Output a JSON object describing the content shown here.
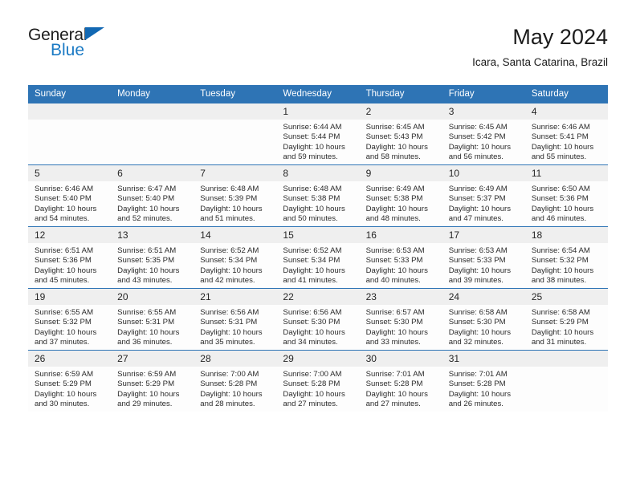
{
  "brand": {
    "name_top": "General",
    "name_bottom": "Blue",
    "accent_color": "#1b7ac4",
    "triangle_color": "#1268b3"
  },
  "header": {
    "title": "May 2024",
    "subtitle": "Icara, Santa Catarina, Brazil"
  },
  "calendar": {
    "header_bg": "#2e74b5",
    "daynum_bg": "#efefef",
    "weekdays": [
      "Sunday",
      "Monday",
      "Tuesday",
      "Wednesday",
      "Thursday",
      "Friday",
      "Saturday"
    ],
    "weeks": [
      [
        {
          "day": "",
          "sunrise": "",
          "sunset": "",
          "daylight_1": "",
          "daylight_2": ""
        },
        {
          "day": "",
          "sunrise": "",
          "sunset": "",
          "daylight_1": "",
          "daylight_2": ""
        },
        {
          "day": "",
          "sunrise": "",
          "sunset": "",
          "daylight_1": "",
          "daylight_2": ""
        },
        {
          "day": "1",
          "sunrise": "Sunrise: 6:44 AM",
          "sunset": "Sunset: 5:44 PM",
          "daylight_1": "Daylight: 10 hours",
          "daylight_2": "and 59 minutes."
        },
        {
          "day": "2",
          "sunrise": "Sunrise: 6:45 AM",
          "sunset": "Sunset: 5:43 PM",
          "daylight_1": "Daylight: 10 hours",
          "daylight_2": "and 58 minutes."
        },
        {
          "day": "3",
          "sunrise": "Sunrise: 6:45 AM",
          "sunset": "Sunset: 5:42 PM",
          "daylight_1": "Daylight: 10 hours",
          "daylight_2": "and 56 minutes."
        },
        {
          "day": "4",
          "sunrise": "Sunrise: 6:46 AM",
          "sunset": "Sunset: 5:41 PM",
          "daylight_1": "Daylight: 10 hours",
          "daylight_2": "and 55 minutes."
        }
      ],
      [
        {
          "day": "5",
          "sunrise": "Sunrise: 6:46 AM",
          "sunset": "Sunset: 5:40 PM",
          "daylight_1": "Daylight: 10 hours",
          "daylight_2": "and 54 minutes."
        },
        {
          "day": "6",
          "sunrise": "Sunrise: 6:47 AM",
          "sunset": "Sunset: 5:40 PM",
          "daylight_1": "Daylight: 10 hours",
          "daylight_2": "and 52 minutes."
        },
        {
          "day": "7",
          "sunrise": "Sunrise: 6:48 AM",
          "sunset": "Sunset: 5:39 PM",
          "daylight_1": "Daylight: 10 hours",
          "daylight_2": "and 51 minutes."
        },
        {
          "day": "8",
          "sunrise": "Sunrise: 6:48 AM",
          "sunset": "Sunset: 5:38 PM",
          "daylight_1": "Daylight: 10 hours",
          "daylight_2": "and 50 minutes."
        },
        {
          "day": "9",
          "sunrise": "Sunrise: 6:49 AM",
          "sunset": "Sunset: 5:38 PM",
          "daylight_1": "Daylight: 10 hours",
          "daylight_2": "and 48 minutes."
        },
        {
          "day": "10",
          "sunrise": "Sunrise: 6:49 AM",
          "sunset": "Sunset: 5:37 PM",
          "daylight_1": "Daylight: 10 hours",
          "daylight_2": "and 47 minutes."
        },
        {
          "day": "11",
          "sunrise": "Sunrise: 6:50 AM",
          "sunset": "Sunset: 5:36 PM",
          "daylight_1": "Daylight: 10 hours",
          "daylight_2": "and 46 minutes."
        }
      ],
      [
        {
          "day": "12",
          "sunrise": "Sunrise: 6:51 AM",
          "sunset": "Sunset: 5:36 PM",
          "daylight_1": "Daylight: 10 hours",
          "daylight_2": "and 45 minutes."
        },
        {
          "day": "13",
          "sunrise": "Sunrise: 6:51 AM",
          "sunset": "Sunset: 5:35 PM",
          "daylight_1": "Daylight: 10 hours",
          "daylight_2": "and 43 minutes."
        },
        {
          "day": "14",
          "sunrise": "Sunrise: 6:52 AM",
          "sunset": "Sunset: 5:34 PM",
          "daylight_1": "Daylight: 10 hours",
          "daylight_2": "and 42 minutes."
        },
        {
          "day": "15",
          "sunrise": "Sunrise: 6:52 AM",
          "sunset": "Sunset: 5:34 PM",
          "daylight_1": "Daylight: 10 hours",
          "daylight_2": "and 41 minutes."
        },
        {
          "day": "16",
          "sunrise": "Sunrise: 6:53 AM",
          "sunset": "Sunset: 5:33 PM",
          "daylight_1": "Daylight: 10 hours",
          "daylight_2": "and 40 minutes."
        },
        {
          "day": "17",
          "sunrise": "Sunrise: 6:53 AM",
          "sunset": "Sunset: 5:33 PM",
          "daylight_1": "Daylight: 10 hours",
          "daylight_2": "and 39 minutes."
        },
        {
          "day": "18",
          "sunrise": "Sunrise: 6:54 AM",
          "sunset": "Sunset: 5:32 PM",
          "daylight_1": "Daylight: 10 hours",
          "daylight_2": "and 38 minutes."
        }
      ],
      [
        {
          "day": "19",
          "sunrise": "Sunrise: 6:55 AM",
          "sunset": "Sunset: 5:32 PM",
          "daylight_1": "Daylight: 10 hours",
          "daylight_2": "and 37 minutes."
        },
        {
          "day": "20",
          "sunrise": "Sunrise: 6:55 AM",
          "sunset": "Sunset: 5:31 PM",
          "daylight_1": "Daylight: 10 hours",
          "daylight_2": "and 36 minutes."
        },
        {
          "day": "21",
          "sunrise": "Sunrise: 6:56 AM",
          "sunset": "Sunset: 5:31 PM",
          "daylight_1": "Daylight: 10 hours",
          "daylight_2": "and 35 minutes."
        },
        {
          "day": "22",
          "sunrise": "Sunrise: 6:56 AM",
          "sunset": "Sunset: 5:30 PM",
          "daylight_1": "Daylight: 10 hours",
          "daylight_2": "and 34 minutes."
        },
        {
          "day": "23",
          "sunrise": "Sunrise: 6:57 AM",
          "sunset": "Sunset: 5:30 PM",
          "daylight_1": "Daylight: 10 hours",
          "daylight_2": "and 33 minutes."
        },
        {
          "day": "24",
          "sunrise": "Sunrise: 6:58 AM",
          "sunset": "Sunset: 5:30 PM",
          "daylight_1": "Daylight: 10 hours",
          "daylight_2": "and 32 minutes."
        },
        {
          "day": "25",
          "sunrise": "Sunrise: 6:58 AM",
          "sunset": "Sunset: 5:29 PM",
          "daylight_1": "Daylight: 10 hours",
          "daylight_2": "and 31 minutes."
        }
      ],
      [
        {
          "day": "26",
          "sunrise": "Sunrise: 6:59 AM",
          "sunset": "Sunset: 5:29 PM",
          "daylight_1": "Daylight: 10 hours",
          "daylight_2": "and 30 minutes."
        },
        {
          "day": "27",
          "sunrise": "Sunrise: 6:59 AM",
          "sunset": "Sunset: 5:29 PM",
          "daylight_1": "Daylight: 10 hours",
          "daylight_2": "and 29 minutes."
        },
        {
          "day": "28",
          "sunrise": "Sunrise: 7:00 AM",
          "sunset": "Sunset: 5:28 PM",
          "daylight_1": "Daylight: 10 hours",
          "daylight_2": "and 28 minutes."
        },
        {
          "day": "29",
          "sunrise": "Sunrise: 7:00 AM",
          "sunset": "Sunset: 5:28 PM",
          "daylight_1": "Daylight: 10 hours",
          "daylight_2": "and 27 minutes."
        },
        {
          "day": "30",
          "sunrise": "Sunrise: 7:01 AM",
          "sunset": "Sunset: 5:28 PM",
          "daylight_1": "Daylight: 10 hours",
          "daylight_2": "and 27 minutes."
        },
        {
          "day": "31",
          "sunrise": "Sunrise: 7:01 AM",
          "sunset": "Sunset: 5:28 PM",
          "daylight_1": "Daylight: 10 hours",
          "daylight_2": "and 26 minutes."
        },
        {
          "day": "",
          "sunrise": "",
          "sunset": "",
          "daylight_1": "",
          "daylight_2": ""
        }
      ]
    ]
  }
}
